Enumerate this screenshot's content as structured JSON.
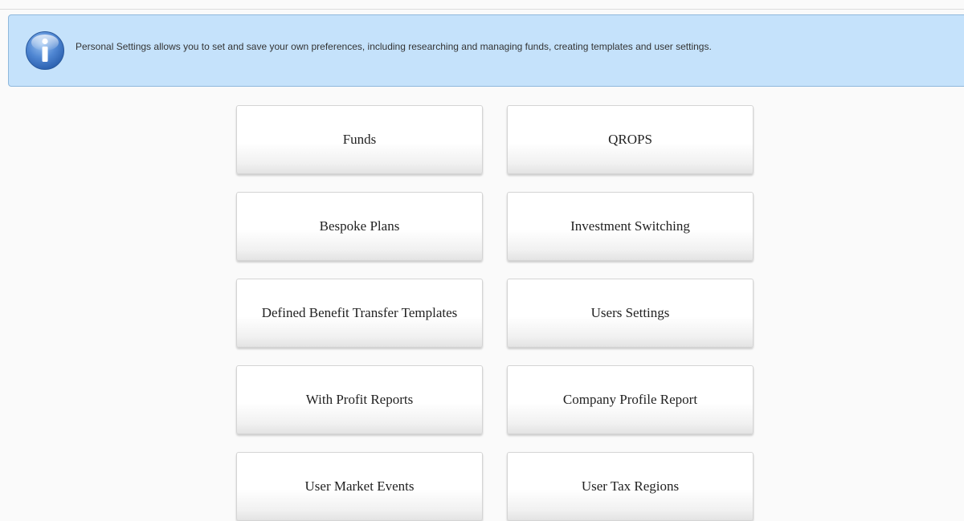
{
  "banner": {
    "icon": "info-icon",
    "text": "Personal Settings allows you to set and save your own preferences, including researching and managing funds, creating templates and user settings."
  },
  "tiles": [
    {
      "label": "Funds"
    },
    {
      "label": "QROPS"
    },
    {
      "label": "Bespoke Plans"
    },
    {
      "label": "Investment Switching"
    },
    {
      "label": "Defined Benefit Transfer Templates"
    },
    {
      "label": "Users Settings"
    },
    {
      "label": "With Profit Reports"
    },
    {
      "label": "Company Profile Report"
    },
    {
      "label": "User Market Events"
    },
    {
      "label": "User Tax Regions"
    }
  ],
  "colors": {
    "banner_background": "#c5e2fb",
    "banner_border": "#8fb8dc",
    "icon_blue": "#3b73c2",
    "page_background": "#fafafa"
  }
}
